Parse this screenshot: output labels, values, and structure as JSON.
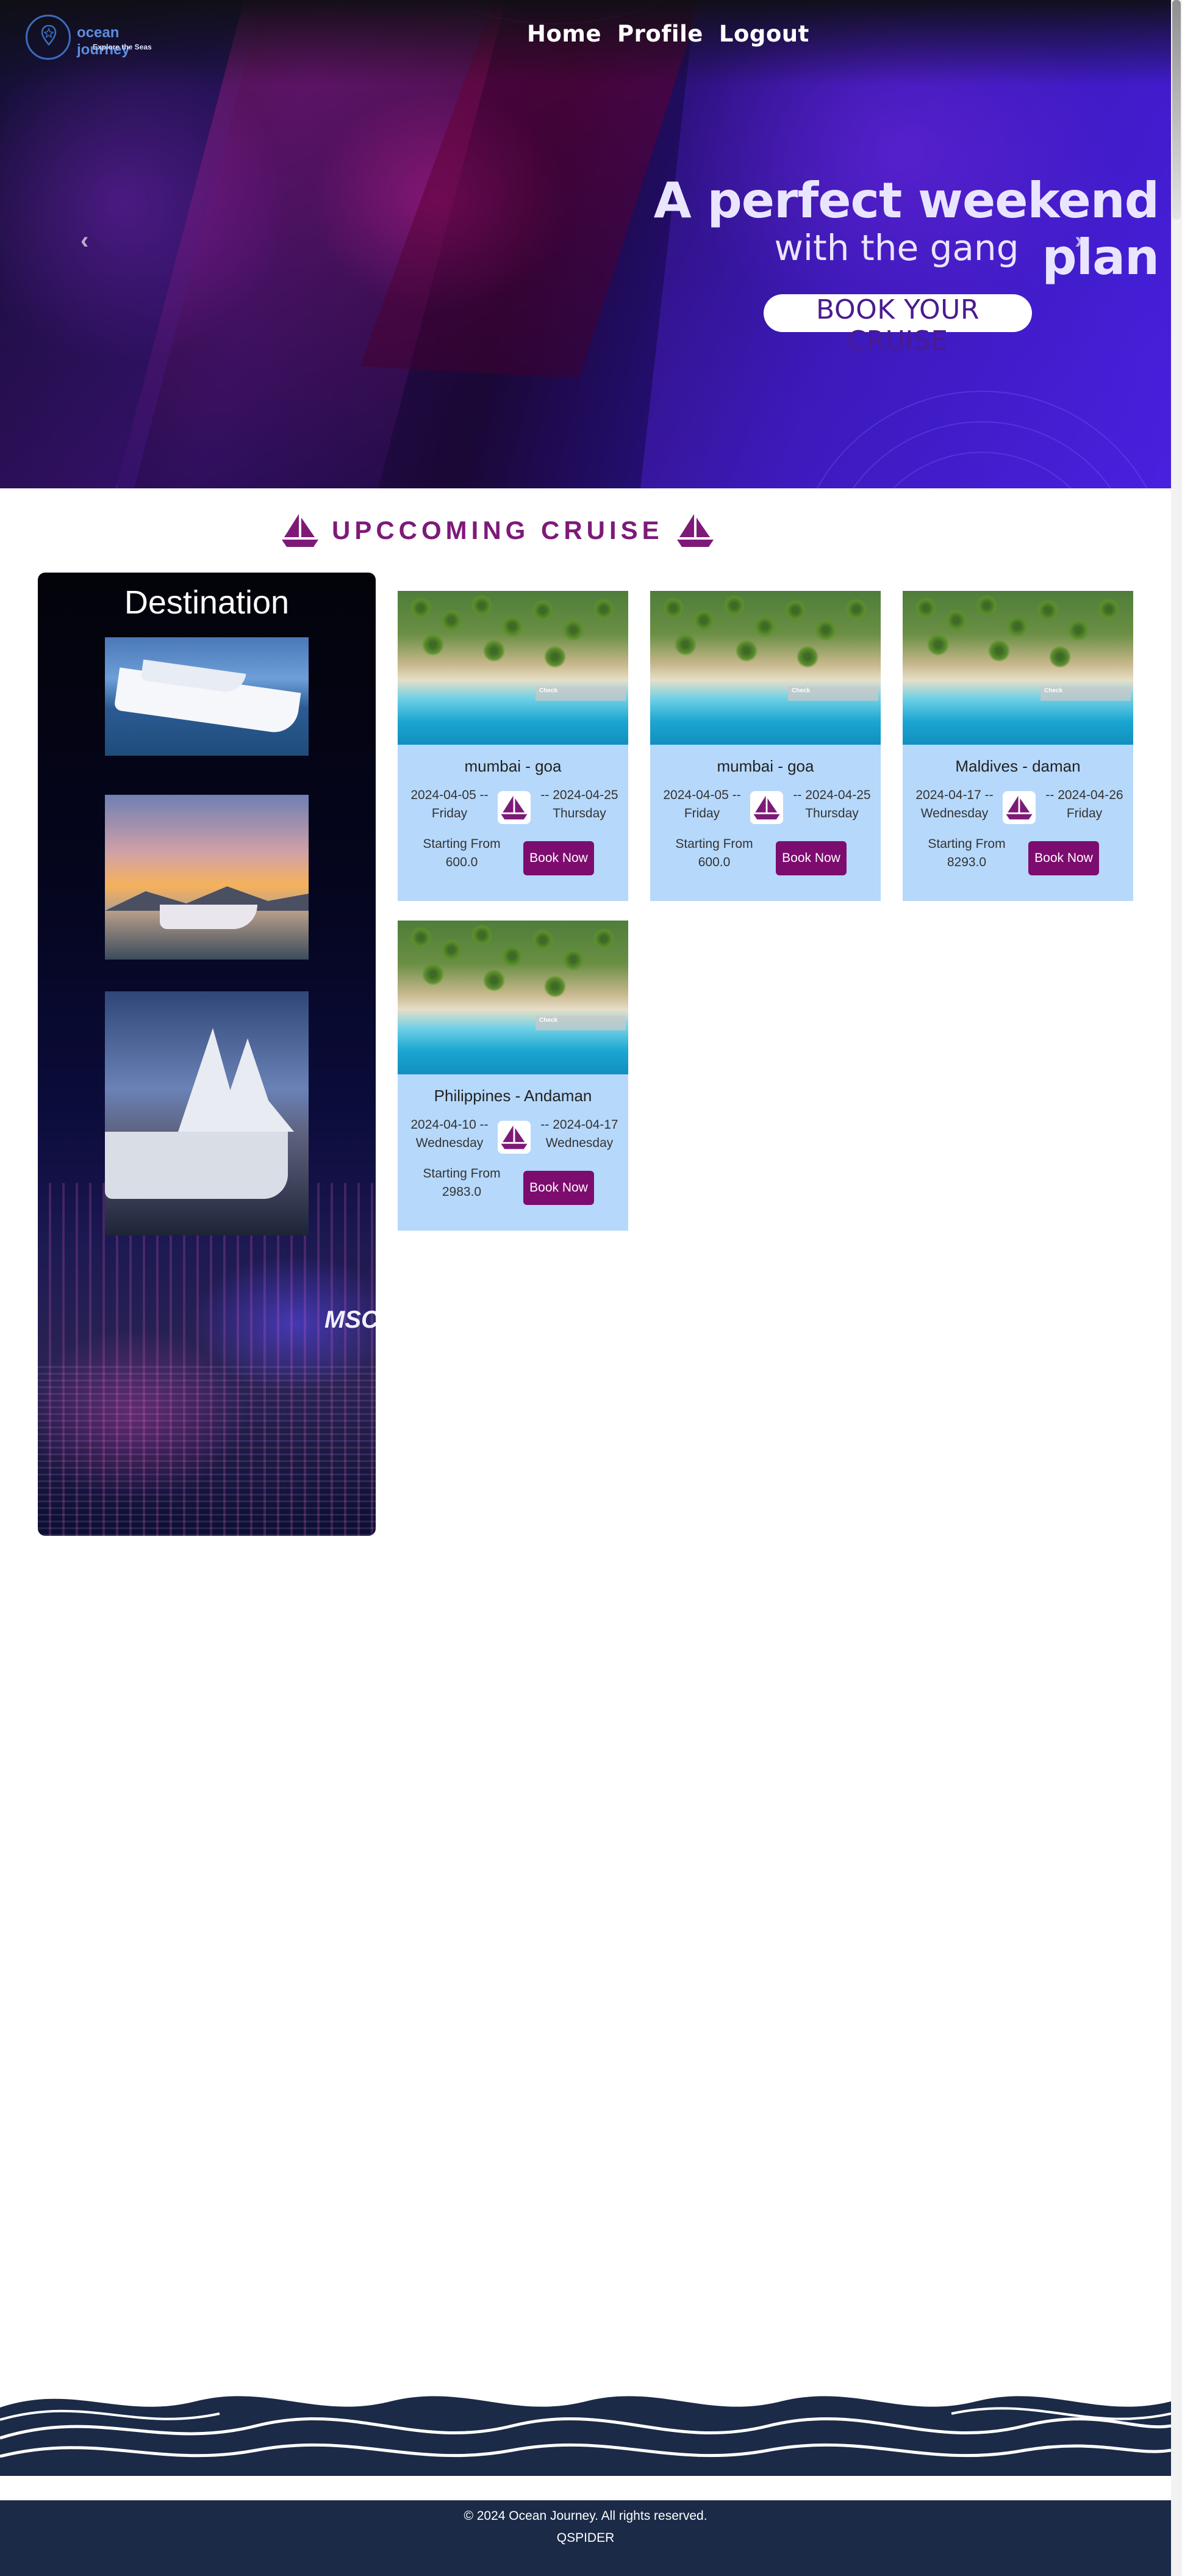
{
  "brand": {
    "name": "ocean journey",
    "tagline": "Explore the Seas"
  },
  "nav": {
    "items": [
      "Home",
      "Profile",
      "Logout"
    ]
  },
  "hero": {
    "title": "A perfect weekend plan",
    "subtitle": "with the gang",
    "cta": "BOOK YOUR CRUISE",
    "prev_icon": "chevron-left-icon",
    "next_icon": "chevron-right-icon"
  },
  "section": {
    "title": "UPCCOMING CRUISE",
    "icon": "sailboat-icon"
  },
  "destination": {
    "title": "Destination",
    "sign": "MSC"
  },
  "cruises": [
    {
      "route": "mumbai - goa",
      "start_date": "2024-04-05 --",
      "start_day": "Friday",
      "end_date": "-- 2024-04-25",
      "end_day": "Thursday",
      "from_label": "Starting From",
      "price": "600.0",
      "book_label": "Book Now"
    },
    {
      "route": "mumbai - goa",
      "start_date": "2024-04-05 --",
      "start_day": "Friday",
      "end_date": "-- 2024-04-25",
      "end_day": "Thursday",
      "from_label": "Starting From",
      "price": "600.0",
      "book_label": "Book Now"
    },
    {
      "route": "Maldives - daman",
      "start_date": "2024-04-17 --",
      "start_day": "Wednesday",
      "end_date": "-- 2024-04-26",
      "end_day": "Friday",
      "from_label": "Starting From",
      "price": "8293.0",
      "book_label": "Book Now"
    },
    {
      "route": "Philippines - Andaman",
      "start_date": "2024-04-10 --",
      "start_day": "Wednesday",
      "end_date": "-- 2024-04-17",
      "end_day": "Wednesday",
      "from_label": "Starting From",
      "price": "2983.0",
      "book_label": "Book Now"
    }
  ],
  "footer": {
    "copyright": "© 2024 Ocean Journey. All rights reserved.",
    "brand": "QSPIDER"
  },
  "colors": {
    "accent": "#7d0c6f",
    "heading": "#7d1a78",
    "card_bg": "#b6d8fb",
    "footer_bg": "#1b2a47"
  }
}
